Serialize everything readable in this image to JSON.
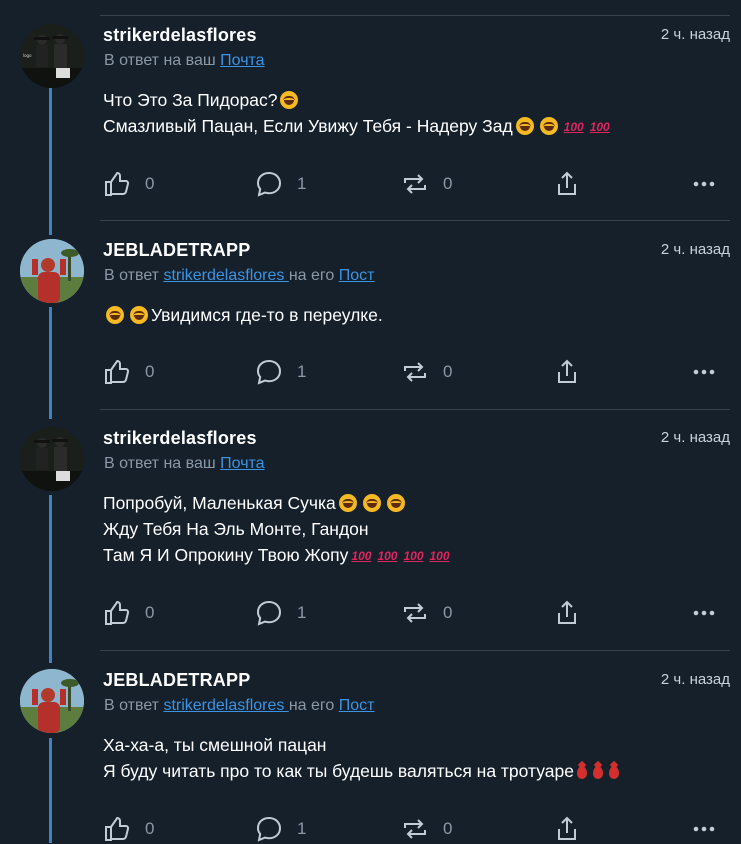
{
  "colors": {
    "background": "#15202b",
    "thread": "#3b84c5",
    "link": "#3b94e4",
    "muted": "#8b98a5"
  },
  "posts": [
    {
      "username": "strikerdelasflores",
      "time": "2 ч. назад",
      "reply_prefix": "В ответ на ваш ",
      "reply_link": "Почта",
      "reply_mid": "",
      "reply_link2": "",
      "lines": [
        "Что Это За Пидорас?",
        "Смазливый Пацан, Если Увижу Тебя - Надеру Зад"
      ],
      "likes": "0",
      "comments": "1",
      "reposts": "0",
      "avatar": "dark-avatar"
    },
    {
      "username": "JEBLADETRAPP",
      "time": "2 ч. назад",
      "reply_prefix": "В ответ ",
      "reply_link": "strikerdelasflores ",
      "reply_mid": "на его ",
      "reply_link2": "Пост",
      "lines": [
        "Увидимся где-то в переулке."
      ],
      "likes": "0",
      "comments": "1",
      "reposts": "0",
      "avatar": "sky-avatar"
    },
    {
      "username": "strikerdelasflores",
      "time": "2 ч. назад",
      "reply_prefix": "В ответ на ваш ",
      "reply_link": "Почта",
      "reply_mid": "",
      "reply_link2": "",
      "lines": [
        "Попробуй, Маленькая Сучка",
        "Жду Тебя На Эль Монте, Гандон",
        "Там Я И Опрокину Твою Жопу"
      ],
      "likes": "0",
      "comments": "1",
      "reposts": "0",
      "avatar": "dark-avatar"
    },
    {
      "username": "JEBLADETRAPP",
      "time": "2 ч. назад",
      "reply_prefix": "В ответ ",
      "reply_link": "strikerdelasflores ",
      "reply_mid": "на его ",
      "reply_link2": "Пост",
      "lines": [
        "Ха-ха-а, ты смешной пацан",
        "Я буду читать про то как ты будешь валяться на тротуаре"
      ],
      "likes": "0",
      "comments": "1",
      "reposts": "0",
      "avatar": "sky-avatar"
    }
  ]
}
